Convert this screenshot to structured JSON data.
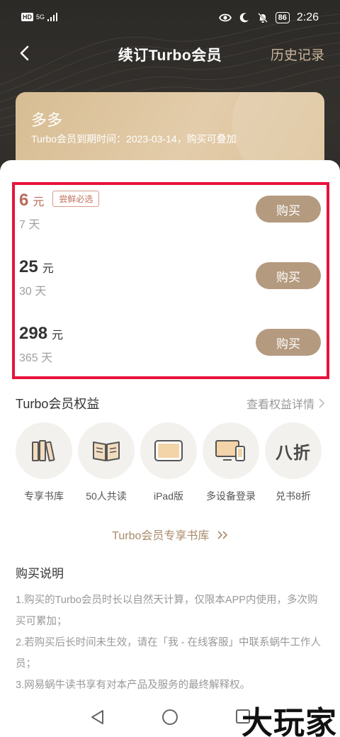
{
  "status_bar": {
    "hd": "HD",
    "signal": "5G",
    "battery": "86",
    "time": "2:26"
  },
  "nav": {
    "title": "续订Turbo会员",
    "history": "历史记录"
  },
  "member_card": {
    "name": "多多",
    "expire_text": "Turbo会员到期时间：2023-03-14，购买可叠加"
  },
  "plans": [
    {
      "price": "6",
      "unit": "元",
      "tag": "尝鲜必选",
      "days": "7 天",
      "button": "购买"
    },
    {
      "price": "25",
      "unit": "元",
      "tag": "",
      "days": "30 天",
      "button": "购买"
    },
    {
      "price": "298",
      "unit": "元",
      "tag": "",
      "days": "365 天",
      "button": "购买"
    }
  ],
  "benefits": {
    "title": "Turbo会员权益",
    "more": "查看权益详情",
    "items": [
      {
        "label": "专享书库",
        "icon": "bookshelf-icon"
      },
      {
        "label": "50人共读",
        "icon": "open-book-icon"
      },
      {
        "label": "iPad版",
        "icon": "tablet-icon"
      },
      {
        "label": "多设备登录",
        "icon": "multi-device-icon"
      },
      {
        "label": "兑书8折",
        "icon": "discount-text",
        "icon_text": "八折"
      }
    ]
  },
  "library_link": "Turbo会员专享书库",
  "purchase_notes": {
    "title": "购买说明",
    "lines": [
      "1.购买的Turbo会员时长以自然天计算，仅限本APP内使用，多次购买可累加；",
      "2.若购买后长时间未生效，请在「我 - 在线客服」中联系蜗牛工作人员；",
      "3.网易蜗牛读书享有对本产品及服务的最终解释权。"
    ]
  },
  "watermark": "大玩家",
  "colors": {
    "accent_gold": "#b49a7f",
    "highlight_border": "#e8133c",
    "price_red": "#b86a58",
    "card_gold": "#dcc29a"
  }
}
